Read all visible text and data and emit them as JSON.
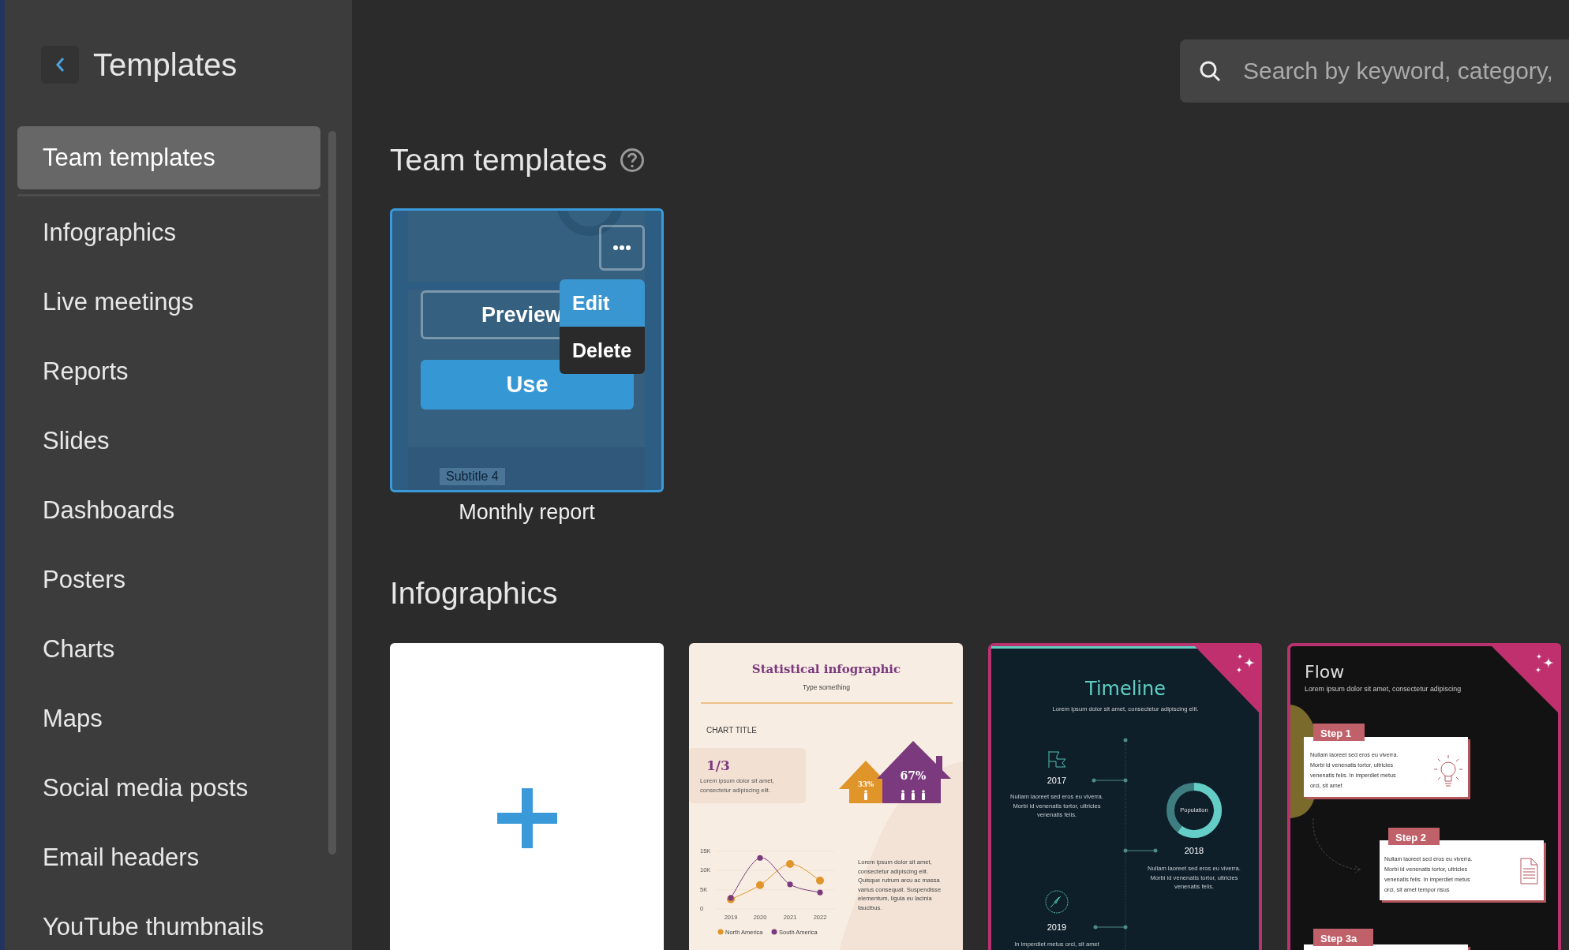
{
  "sidebar": {
    "title": "Templates",
    "items": [
      {
        "label": "Team templates",
        "selected": true
      },
      {
        "label": "Infographics",
        "selected": false
      },
      {
        "label": "Live meetings",
        "selected": false
      },
      {
        "label": "Reports",
        "selected": false
      },
      {
        "label": "Slides",
        "selected": false
      },
      {
        "label": "Dashboards",
        "selected": false
      },
      {
        "label": "Posters",
        "selected": false
      },
      {
        "label": "Charts",
        "selected": false
      },
      {
        "label": "Maps",
        "selected": false
      },
      {
        "label": "Social media posts",
        "selected": false
      },
      {
        "label": "Email headers",
        "selected": false
      },
      {
        "label": "YouTube thumbnails",
        "selected": false
      }
    ]
  },
  "search": {
    "placeholder": "Search by keyword, category,"
  },
  "team_templates": {
    "heading": "Team templates",
    "cards": [
      {
        "name": "Monthly report",
        "hovered": true,
        "thumbnail_text": "Subtitle 4",
        "preview": "Preview",
        "use": "Use",
        "menu": [
          {
            "label": "Edit",
            "selected": true
          },
          {
            "label": "Delete",
            "selected": false
          }
        ]
      }
    ]
  },
  "infographics": {
    "heading": "Infographics",
    "cards": [
      {
        "kind": "blank"
      },
      {
        "kind": "statistical",
        "title": "Statistical infographic",
        "subtitle": "Type something",
        "chart_title": "CHART TITLE",
        "stat_value": "1/3",
        "stat_text": [
          "Lorem ipsum dolor sit amet,",
          "consectetur adipiscing elit."
        ],
        "houses": [
          "33%",
          "67%"
        ],
        "chart_data": {
          "type": "line",
          "legend": "bottom",
          "categories": [
            "2019",
            "2020",
            "2021",
            "2022"
          ],
          "ylim": [
            0,
            15000
          ],
          "yticks": [
            {
              "value": 0,
              "label": "0"
            },
            {
              "value": 5000,
              "label": "5K"
            },
            {
              "value": 10000,
              "label": "10K"
            },
            {
              "value": 15000,
              "label": "15K"
            }
          ],
          "series": [
            {
              "name": "North America",
              "color": "#e0952a",
              "marker": "circle",
              "values": [
                2500,
                6200,
                11700,
                7400
              ]
            },
            {
              "name": "South America",
              "color": "#7b3a7e",
              "marker": "circle",
              "values": [
                2900,
                13300,
                6400,
                4300
              ]
            }
          ]
        },
        "body": [
          "Lorem ipsum dolor sit amet,",
          "consectetur adipiscing elit.",
          "Quisque rutrum arcu ac massa",
          "varius consequat. Suspendisse",
          "elementum, ligula eu lacinia",
          "faucibus."
        ]
      },
      {
        "kind": "timeline",
        "title": "Timeline",
        "subtitle": "Lorem ipsum dolor sit amet, consectetur adipiscing elit.",
        "events": [
          {
            "year": "2017",
            "text": [
              "Nullam laoreet sed eros eu viverra.",
              "Morbi id venenatis tortor, ultricies",
              "venenatis felis."
            ]
          },
          {
            "year": "2018",
            "figure_label": "Population",
            "text": [
              "Nullam laoreet sed eros eu viverra.",
              "Morbi id venenatis tortor, ultricies",
              "venenatis felis."
            ]
          },
          {
            "year": "2019",
            "text": [
              "In imperdiet metus orci, sit amet"
            ]
          }
        ]
      },
      {
        "kind": "flow",
        "title": "Flow",
        "subtitle": "Lorem ipsum dolor sit amet, consectetur adipiscing",
        "steps": [
          {
            "label": "Step 1",
            "text": [
              "Nullam laoreet sed eros eu viverra.",
              "Morbi id venenatis tortor, ultricies",
              "venenatis felis. In imperdiet metus",
              "orci, sit amet"
            ]
          },
          {
            "label": "Step 2",
            "text": [
              "Nullam laoreet sed eros eu viverra.",
              "Morbi id venenatis tortor, ultricies",
              "venenatis felis. In imperdiet metus",
              "orci, sit amet tempor risus"
            ]
          },
          {
            "label": "Step 3a"
          }
        ]
      }
    ]
  }
}
